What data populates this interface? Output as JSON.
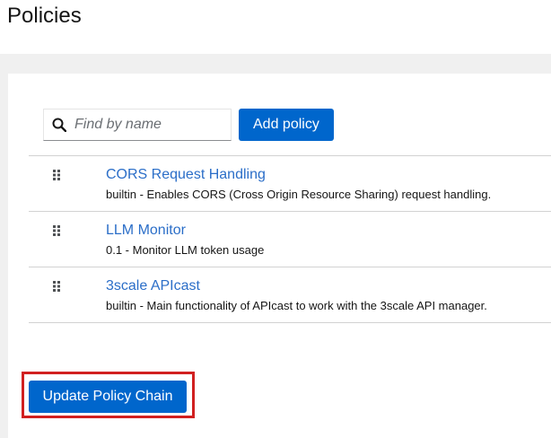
{
  "page": {
    "title": "Policies"
  },
  "search": {
    "placeholder": "Find by name",
    "value": "",
    "icon": "search-icon"
  },
  "toolbar": {
    "add_label": "Add policy"
  },
  "policies": [
    {
      "name": "CORS Request Handling",
      "version": "builtin",
      "description": "builtin - Enables CORS (Cross Origin Resource Sharing) request handling."
    },
    {
      "name": "LLM Monitor",
      "version": "0.1",
      "description": "0.1 - Monitor LLM token usage"
    },
    {
      "name": "3scale APIcast",
      "version": "builtin",
      "description": "builtin - Main functionality of APIcast to work with the 3scale API manager."
    }
  ],
  "footer": {
    "update_label": "Update Policy Chain"
  },
  "colors": {
    "primary": "#0066cc",
    "link": "#2b6ec8",
    "highlight": "#d12020",
    "page_bg": "#f0f0f0"
  }
}
